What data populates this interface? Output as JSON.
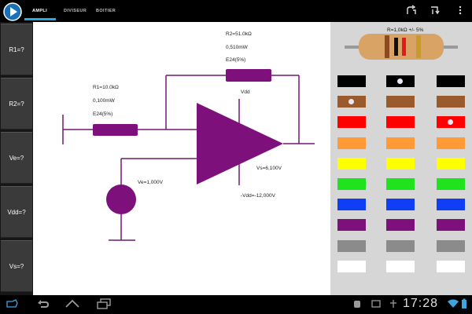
{
  "app": {
    "tabs": [
      "AMPLI",
      "DIVISEUR",
      "BOITIER"
    ]
  },
  "leftbar": {
    "buttons": [
      "R1=?",
      "R2=?",
      "Ve=?",
      "Vdd=?",
      "Vs=?"
    ]
  },
  "circuit": {
    "r1": {
      "value": "R1=10.0kΩ",
      "power": "0,100mW",
      "series": "E24(5%)"
    },
    "r2": {
      "value": "R2=51.0kΩ",
      "power": "0,510mW",
      "series": "E24(5%)"
    },
    "vdd_label": "Vdd",
    "ve_label": "Ve=1,000V",
    "vs_label": "Vs=6,100V",
    "neg_vdd_label": "-Vdd=-12,000V"
  },
  "palette": {
    "resistor_label": "R=1,0kΩ  +/- 5%",
    "colors": [
      "#000000",
      "#9a5a2c",
      "#ff0000",
      "#ff9a36",
      "#ffff00",
      "#1fe31f",
      "#0f3ef5",
      "#7d107a",
      "#8b8b8b",
      "#ffffff"
    ],
    "selected_col1_row": 1,
    "selected_col2_row": 0,
    "selected_col3_row": 2
  },
  "statusbar": {
    "time": "17:28"
  }
}
